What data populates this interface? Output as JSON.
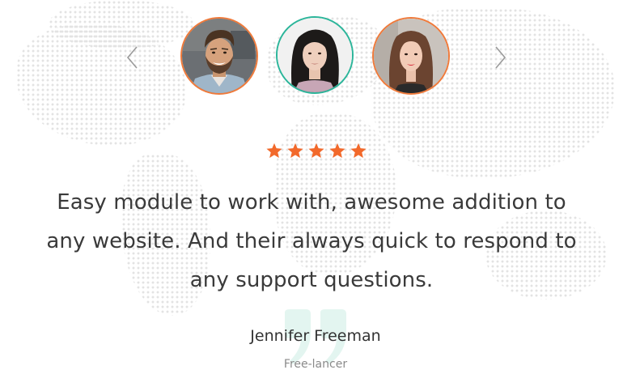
{
  "testimonial": {
    "rating": 5,
    "quote_lines": [
      "Easy module to work with, awesome addition to",
      "any website. And their always quick to respond to",
      "any support questions."
    ],
    "author_name": "Jennifer Freeman",
    "author_role": "Free-lancer"
  },
  "avatars": [
    {
      "name": "avatar-man",
      "active": false
    },
    {
      "name": "avatar-woman-active",
      "active": true
    },
    {
      "name": "avatar-woman",
      "active": false
    }
  ],
  "colors": {
    "accent_orange": "#f07a3a",
    "accent_teal": "#2bb59a",
    "star": "#f2692b",
    "quote_mark": "#e3f5f0",
    "text": "#3a3a3a",
    "muted": "#8a8a8a"
  },
  "icons": {
    "prev": "chevron-left-icon",
    "next": "chevron-right-icon",
    "star": "star-icon",
    "quote": "quote-icon"
  }
}
